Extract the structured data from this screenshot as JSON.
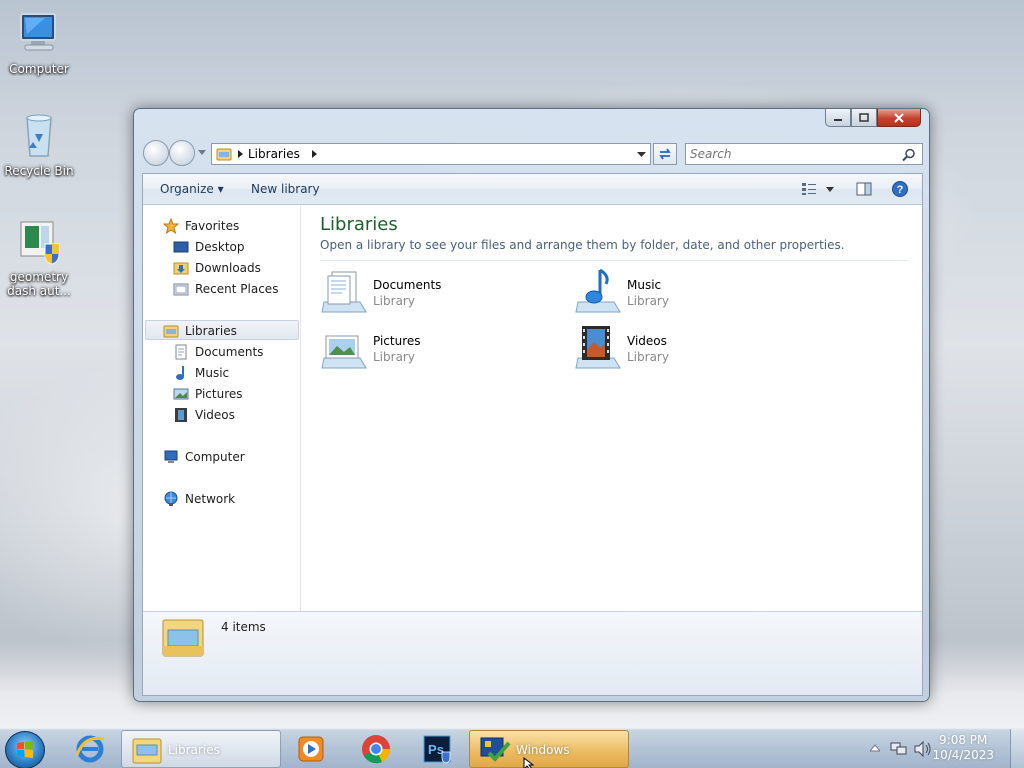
{
  "desktop": {
    "icons": [
      {
        "label": "Computer"
      },
      {
        "label": "Recycle Bin"
      },
      {
        "label": "geometry dash aut..."
      }
    ]
  },
  "window": {
    "address": {
      "path": "Libraries"
    },
    "search": {
      "placeholder": "Search"
    },
    "commands": {
      "organize": "Organize ▾",
      "new_library": "New library"
    },
    "sidebar": {
      "favorites": {
        "label": "Favorites",
        "items": [
          "Desktop",
          "Downloads",
          "Recent Places"
        ]
      },
      "libraries": {
        "label": "Libraries",
        "items": [
          "Documents",
          "Music",
          "Pictures",
          "Videos"
        ]
      },
      "computer": {
        "label": "Computer"
      },
      "network": {
        "label": "Network"
      }
    },
    "main": {
      "title": "Libraries",
      "description": "Open a library to see your files and arrange them by folder, date, and other properties.",
      "libraries": [
        {
          "name": "Documents",
          "type": "Library",
          "icon": "documents-library-icon"
        },
        {
          "name": "Music",
          "type": "Library",
          "icon": "music-library-icon"
        },
        {
          "name": "Pictures",
          "type": "Library",
          "icon": "pictures-library-icon"
        },
        {
          "name": "Videos",
          "type": "Library",
          "icon": "videos-library-icon"
        }
      ]
    },
    "details": {
      "count": "4 items"
    }
  },
  "taskbar": {
    "buttons": [
      {
        "label": "Libraries",
        "icon": "explorer-icon"
      },
      {
        "label": "Windows",
        "icon": "windows-activation-icon"
      }
    ],
    "pinned": [
      "internet-explorer-icon",
      "media-player-icon",
      "chrome-icon",
      "photoshop-icon"
    ],
    "clock": {
      "time": "9:08 PM",
      "date": "10/4/2023"
    }
  }
}
